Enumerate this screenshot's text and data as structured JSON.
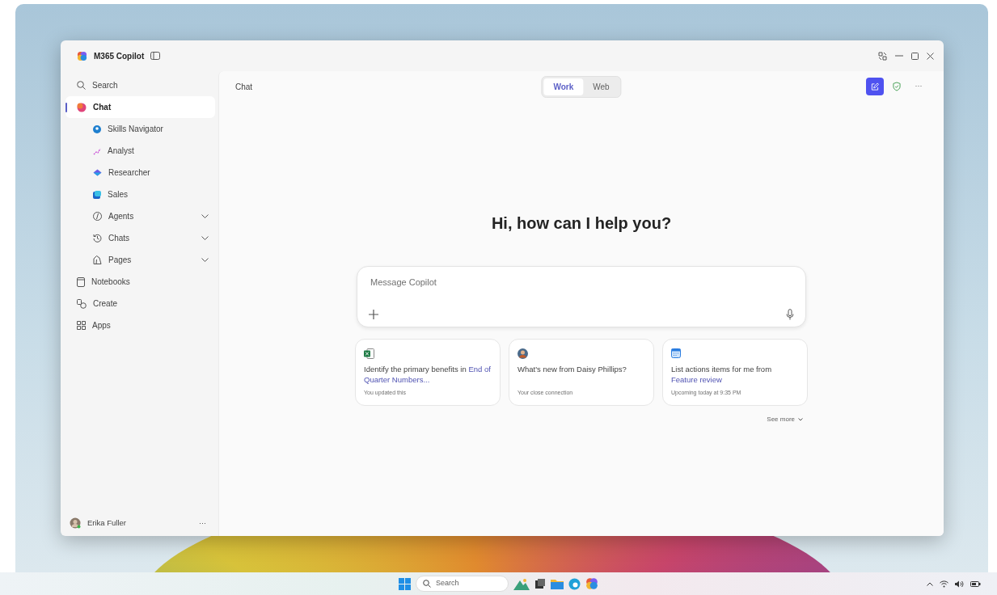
{
  "window": {
    "title": "M365 Copilot"
  },
  "sidebar": {
    "search": "Search",
    "items": [
      {
        "label": "Chat",
        "kind": "nav",
        "selected": true,
        "children": [
          {
            "label": "Skills Navigator",
            "kind": "agent",
            "selected": false
          },
          {
            "label": "Analyst",
            "kind": "agent",
            "selected": false
          },
          {
            "label": "Researcher",
            "kind": "agent",
            "selected": false
          },
          {
            "label": "Sales",
            "kind": "agent",
            "selected": false
          },
          {
            "label": "Agents",
            "kind": "group",
            "expanded": false,
            "selected": false
          },
          {
            "label": "Chats",
            "kind": "group",
            "expanded": false,
            "selected": false
          },
          {
            "label": "Pages",
            "kind": "group",
            "expanded": false,
            "selected": false
          }
        ]
      },
      {
        "label": "Notebooks",
        "kind": "nav",
        "selected": false
      },
      {
        "label": "Create",
        "kind": "nav",
        "selected": false
      },
      {
        "label": "Apps",
        "kind": "nav",
        "selected": false
      }
    ],
    "user": {
      "name": "Erika Fuller",
      "more": "···"
    }
  },
  "header": {
    "title": "Chat",
    "tabs": [
      {
        "label": "Work",
        "selected": true
      },
      {
        "label": "Web",
        "selected": false
      }
    ],
    "more": "···"
  },
  "main": {
    "greeting": "Hi, how can I help you?",
    "composer": {
      "placeholder": "Message Copilot"
    },
    "suggestions": [
      {
        "kind": "spreadsheet",
        "text": "Identify the primary benefits in ",
        "link": "End of Quarter Numbers...",
        "note": "You updated this"
      },
      {
        "kind": "person",
        "text": "What's new from Daisy Phillips?",
        "note": "Your close connection"
      },
      {
        "kind": "calendar",
        "text": "List actions items for me from ",
        "link": "Feature review",
        "note": "Upcoming today at 9:35 PM"
      }
    ],
    "see_more": "See more"
  },
  "taskbar": {
    "search": "Search"
  }
}
